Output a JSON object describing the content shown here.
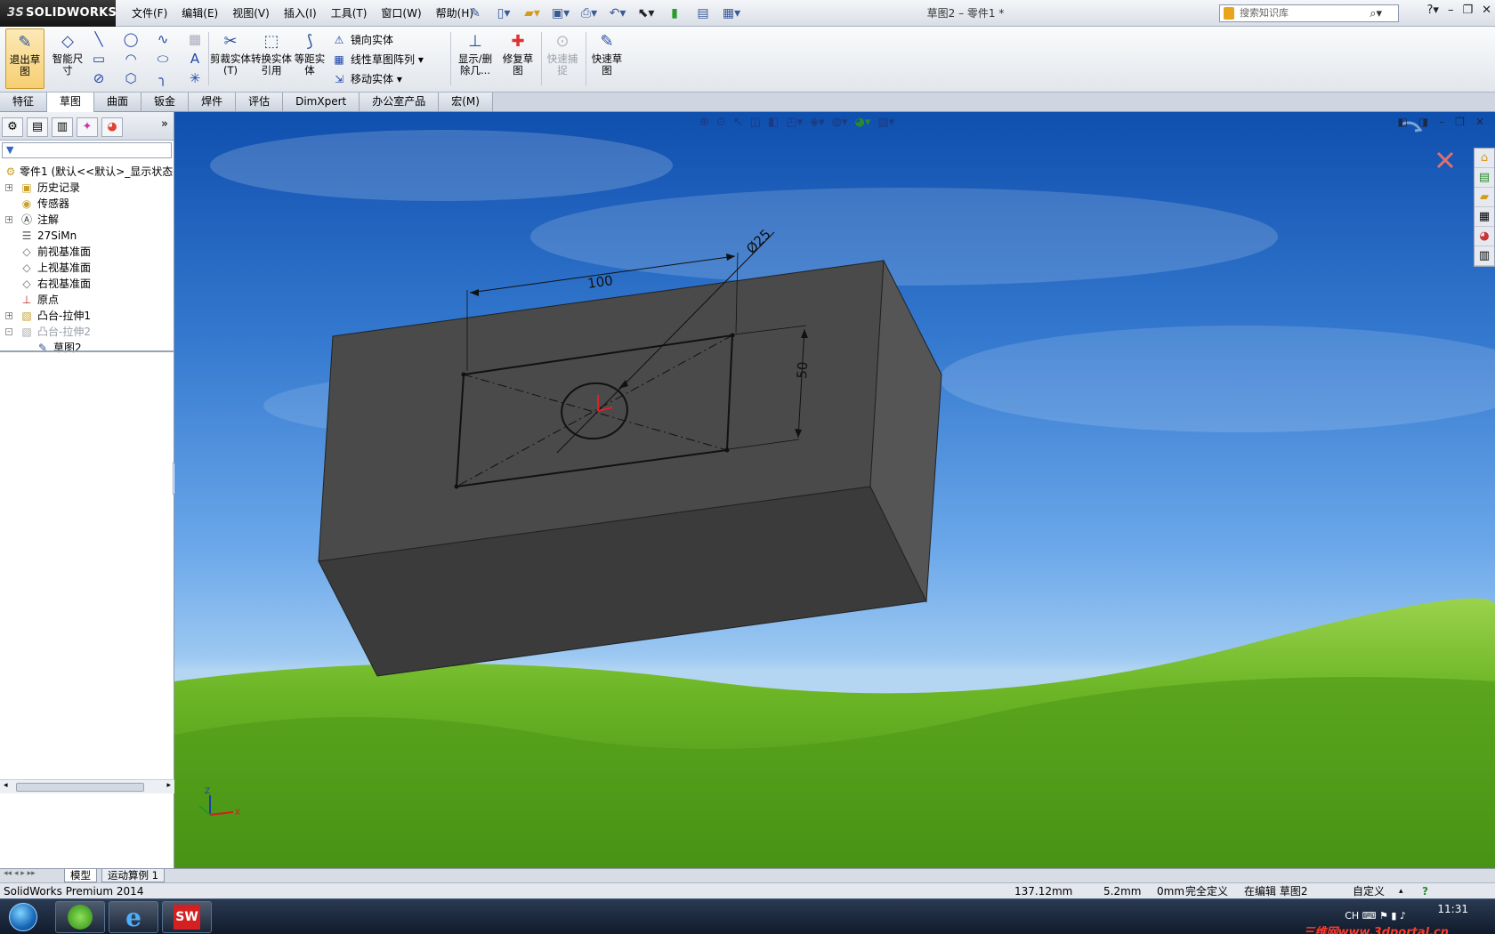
{
  "app": {
    "logo_text": "SOLIDWORKS",
    "logo_prefix": "3S",
    "document_title": "草图2 – 零件1 *"
  },
  "menus": [
    "文件(F)",
    "编辑(E)",
    "视图(V)",
    "插入(I)",
    "工具(T)",
    "窗口(W)",
    "帮助(H)"
  ],
  "search": {
    "placeholder": "搜索知识库"
  },
  "commands": {
    "exit_sketch": "退出草图",
    "smart_dimension": "智能尺寸",
    "trim": "剪裁实体(T)",
    "convert": "转换实体引用",
    "offset": "等距实体",
    "mirror": "镜向实体",
    "linear_pattern": "线性草图阵列",
    "move": "移动实体",
    "display_delete": "显示/删除几...",
    "repair": "修复草图",
    "quick_snap": "快速捕捉",
    "rapid_sketch": "快速草图"
  },
  "tabs": [
    "特征",
    "草图",
    "曲面",
    "钣金",
    "焊件",
    "评估",
    "DimXpert",
    "办公室产品",
    "宏(M)"
  ],
  "active_tab_index": 1,
  "feature_tree": {
    "root": "零件1  (默认<<默认>_显示状态",
    "items": [
      {
        "label": "历史记录",
        "icon": "history-icon"
      },
      {
        "label": "传感器",
        "icon": "sensor-icon"
      },
      {
        "label": "注解",
        "icon": "annotation-icon"
      },
      {
        "label": "27SiMn",
        "icon": "material-icon"
      },
      {
        "label": "前视基准面",
        "icon": "plane-icon"
      },
      {
        "label": "上视基准面",
        "icon": "plane-icon"
      },
      {
        "label": "右视基准面",
        "icon": "plane-icon"
      },
      {
        "label": "原点",
        "icon": "origin-icon"
      },
      {
        "label": "凸台-拉伸1",
        "icon": "boss-extrude-icon"
      },
      {
        "label": "凸台-拉伸2",
        "icon": "boss-extrude-icon"
      }
    ],
    "child": {
      "label": "草图2",
      "icon": "sketch-icon"
    }
  },
  "sketch_dims": {
    "length": "100",
    "width": "50",
    "diameter": "Ø25"
  },
  "bottom_tabs": [
    "模型",
    "运动算例 1"
  ],
  "status": {
    "product": "SolidWorks Premium 2014",
    "x": "137.12mm",
    "y": "5.2mm",
    "z": "0mm",
    "defined": "完全定义",
    "editing": "在编辑 草图2",
    "units": "自定义"
  },
  "taskbar": {
    "time": "11:31",
    "lang": "CH",
    "watermark": "三维网www.3dportal.cn"
  },
  "colors": {
    "accent": "#3565c7",
    "part_top": "#4a4a4a",
    "part_side": "#3b3b3b",
    "sky": "#3479cf",
    "grass": "#5aa21e"
  }
}
